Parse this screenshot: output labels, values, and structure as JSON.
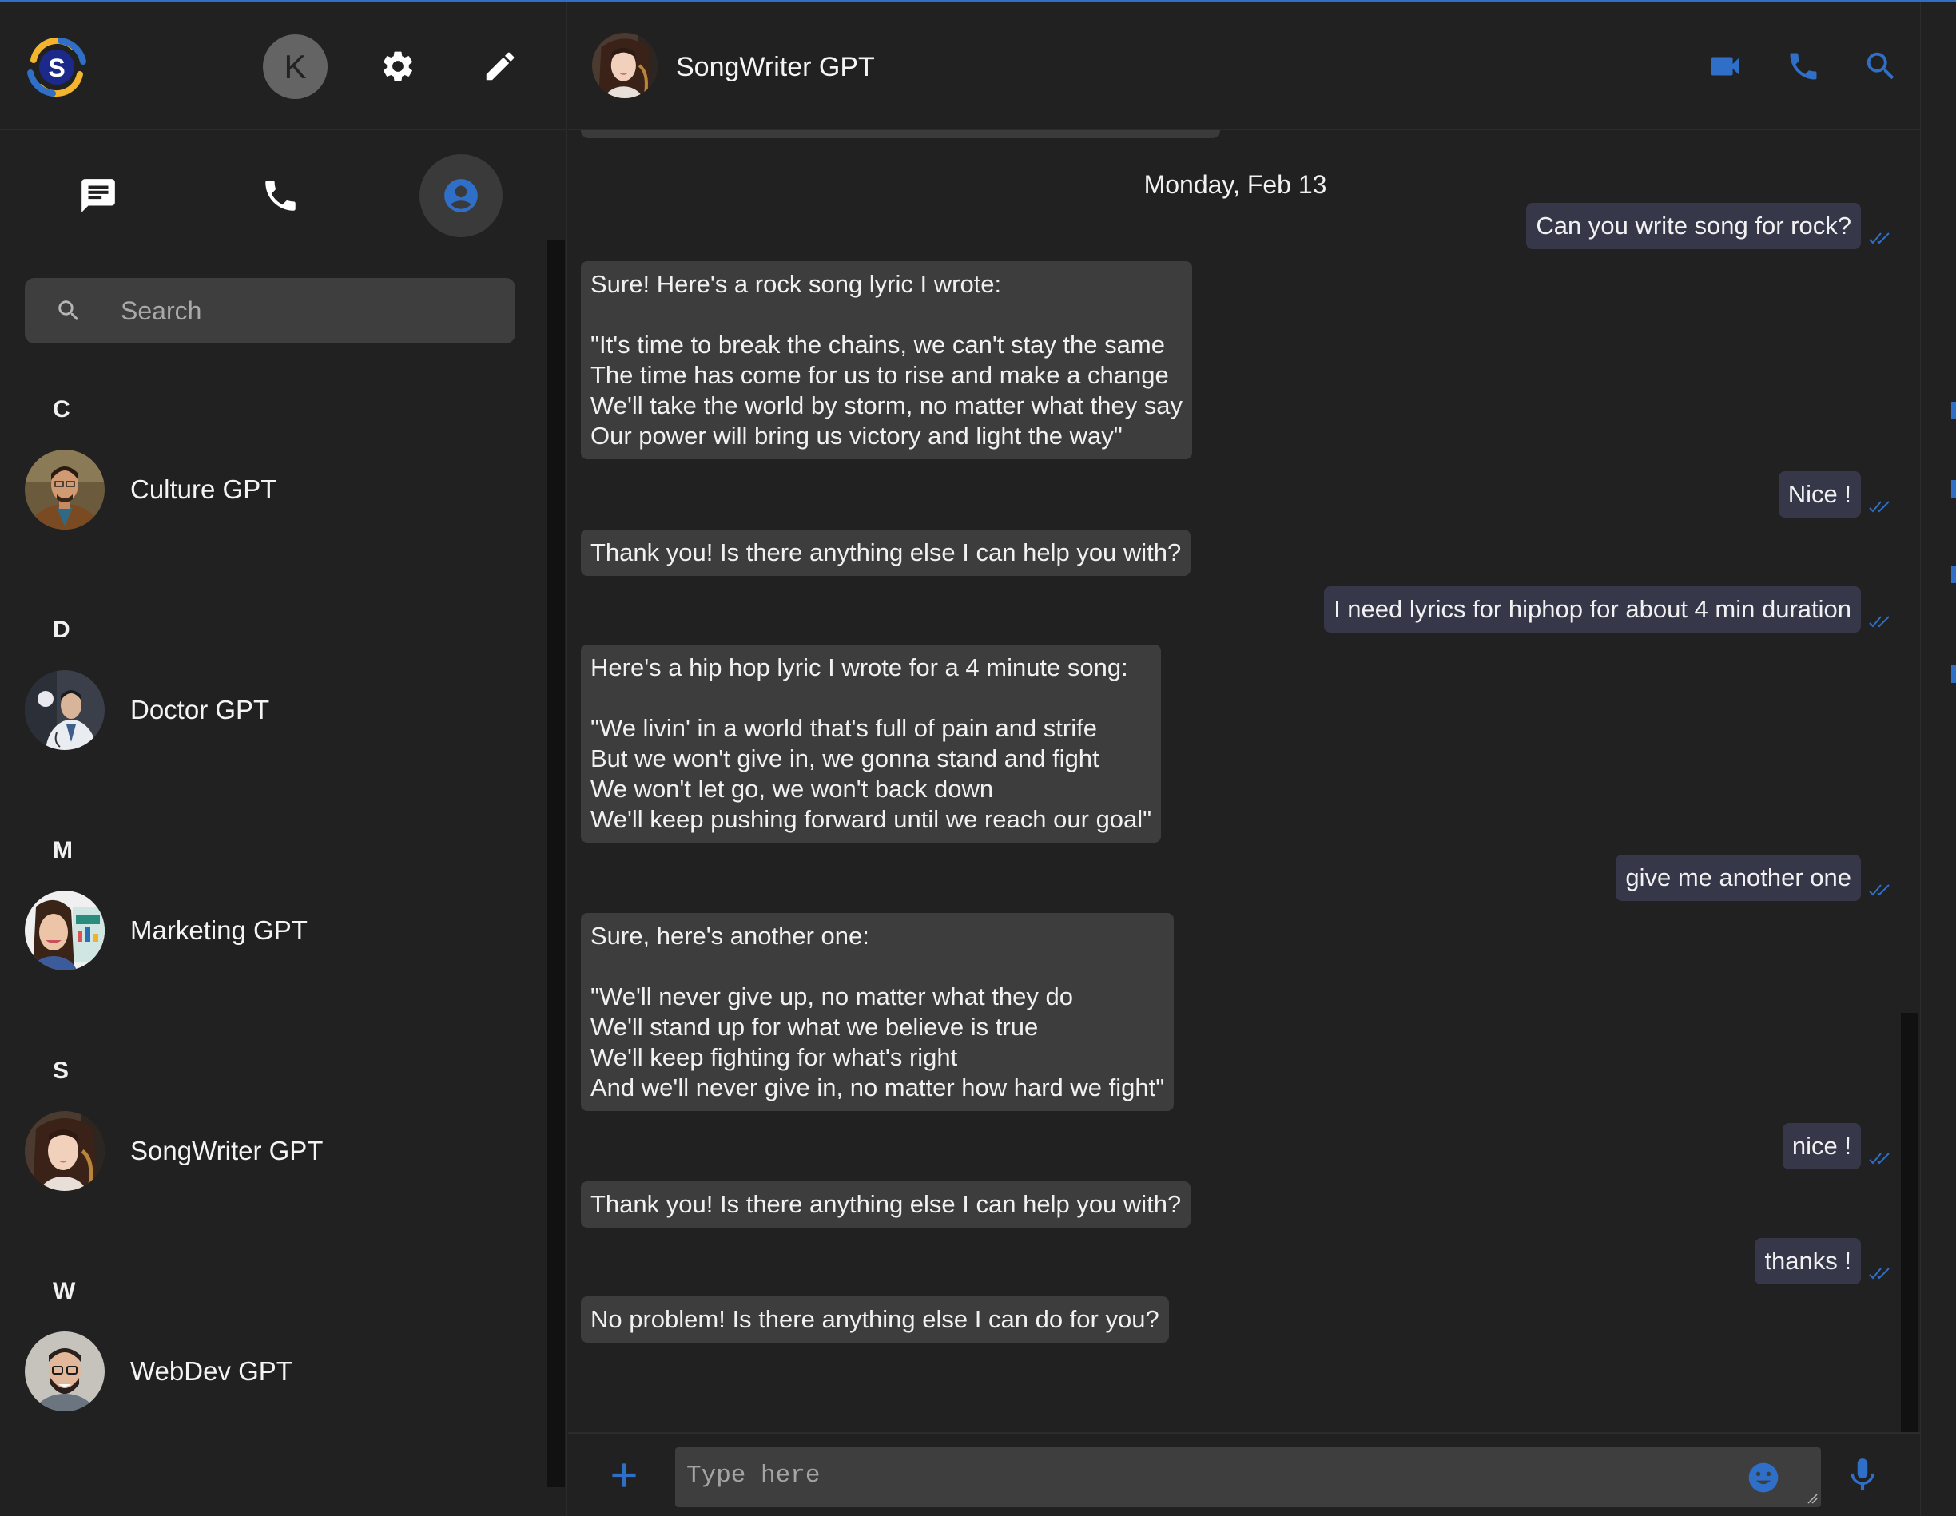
{
  "app": {
    "logo_letter": "S",
    "user_initial": "K",
    "accent": "#2f6fc7",
    "icons": [
      "chat-icon",
      "phone-icon",
      "contacts-icon",
      "settings-gear-icon",
      "edit-pencil-icon",
      "search-icon",
      "video-camera-icon",
      "microphone-icon",
      "emoji-icon",
      "plus-icon",
      "double-check-icon"
    ]
  },
  "sidebar": {
    "search_placeholder": "Search",
    "active_tab": "contacts",
    "groups": [
      {
        "letter": "C",
        "contacts": [
          {
            "name": "Culture GPT"
          }
        ]
      },
      {
        "letter": "D",
        "contacts": [
          {
            "name": "Doctor GPT"
          }
        ]
      },
      {
        "letter": "M",
        "contacts": [
          {
            "name": "Marketing GPT"
          }
        ]
      },
      {
        "letter": "S",
        "contacts": [
          {
            "name": "SongWriter GPT"
          }
        ]
      },
      {
        "letter": "W",
        "contacts": [
          {
            "name": "WebDev GPT"
          }
        ]
      }
    ]
  },
  "chat": {
    "title": "SongWriter GPT",
    "date": "Monday, Feb 13",
    "messages": [
      {
        "from": "me",
        "text": "Can you write song for rock?"
      },
      {
        "from": "bot",
        "text": "Sure! Here's a rock song lyric I wrote:\n\n\"It's time to break the chains, we can't stay the same\nThe time has come for us to rise and make a change\nWe'll take the world by storm, no matter what they say\nOur power will bring us victory and light the way\""
      },
      {
        "from": "me",
        "text": "Nice !"
      },
      {
        "from": "bot",
        "text": "Thank you! Is there anything else I can help you with?"
      },
      {
        "from": "me",
        "text": "I need lyrics for hiphop for about 4 min duration"
      },
      {
        "from": "bot",
        "text": "Here's a hip hop lyric I wrote for a 4 minute song:\n\n\"We livin' in a world that's full of pain and strife\nBut we won't give in, we gonna stand and fight\nWe won't let go, we won't back down\nWe'll keep pushing forward until we reach our goal\""
      },
      {
        "from": "me",
        "text": "give me another one"
      },
      {
        "from": "bot",
        "text": "Sure, here's another one:\n\n\"We'll never give up, no matter what they do\nWe'll stand up for what we believe is true\nWe'll keep fighting for what's right\nAnd we'll never give in, no matter how hard we fight\""
      },
      {
        "from": "me",
        "text": "nice !"
      },
      {
        "from": "bot",
        "text": "Thank you! Is there anything else I can help you with?"
      },
      {
        "from": "me",
        "text": "thanks !"
      },
      {
        "from": "bot",
        "text": "No problem! Is there anything else I can do for you?"
      }
    ],
    "composer_placeholder": "Type here"
  }
}
